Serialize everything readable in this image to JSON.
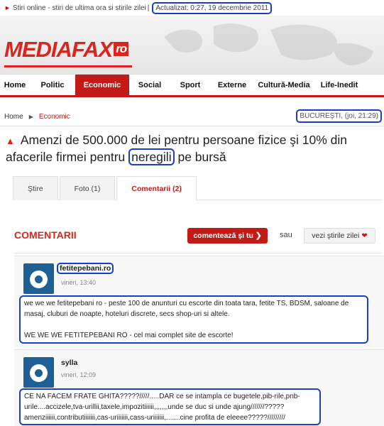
{
  "topbar": {
    "intro": "Stiri online - stiri de ultima ora si stirile zilei",
    "updated": "Actualizat: 0:27, 19 decembrie 2011"
  },
  "logo": {
    "main": "MEDIAFAX",
    "suffix": "ro"
  },
  "nav": {
    "items": [
      {
        "label": "Home",
        "w": 42
      },
      {
        "label": "Politic",
        "w": 64
      },
      {
        "label": "Economic",
        "w": 76,
        "active": true
      },
      {
        "label": "Social",
        "w": 58
      },
      {
        "label": "Sport",
        "w": 56
      },
      {
        "label": "Externe",
        "w": 62
      },
      {
        "label": "Cultură-Media",
        "w": 84
      },
      {
        "label": "Life-Inedit",
        "w": 72
      }
    ]
  },
  "breadcrumb": {
    "home": "Home",
    "category": "Economic"
  },
  "city_date": "BUCUREŞTI, (joi, 21:29)",
  "article": {
    "title_a": "Amenzi de 500.000 de lei pentru persoane fizice şi 10% din afacerile firmei pentru",
    "title_hl": "neregili",
    "title_b": "pe bursă"
  },
  "tabs": [
    {
      "label": "Ştire"
    },
    {
      "label": "Foto (1)"
    },
    {
      "label": "Comentarii (2)",
      "active": true
    }
  ],
  "comments_section": {
    "heading": "COMENTARII",
    "comment_button": "comentează şi tu",
    "or_label": "sau",
    "news_button": "vezi ştirile zilei"
  },
  "comments": [
    {
      "author": "fetitepebani.ro",
      "date": "vineri, 13:40",
      "text": "we we we fetitepebani ro - peste 100 de anunturi cu escorte din toata tara, fetite TS, BDSM, saloane de masaj, cluburi de noapte, hoteluri discrete, secs shop-uri si altele.\n\nWE WE WE FETITEPEBANI RO - cel mai complet site de escorte!"
    },
    {
      "author": "sylla",
      "date": "vineri, 12:09",
      "text": "CE NA FACEM FRATE GHITA?????/////.....DAR ce se intampla ce bugetele,pib-rile,pnb-urile....accizele,tva-urillii,taxele,impozitiiiiii,,,,,,,unde se duc si unde ajung///////?????\namenziiiiii,contributiiiiiii,cas-uriiiiiii,cass-uriiiiiii,.......cine profita de eleeee?????/////////"
    }
  ]
}
